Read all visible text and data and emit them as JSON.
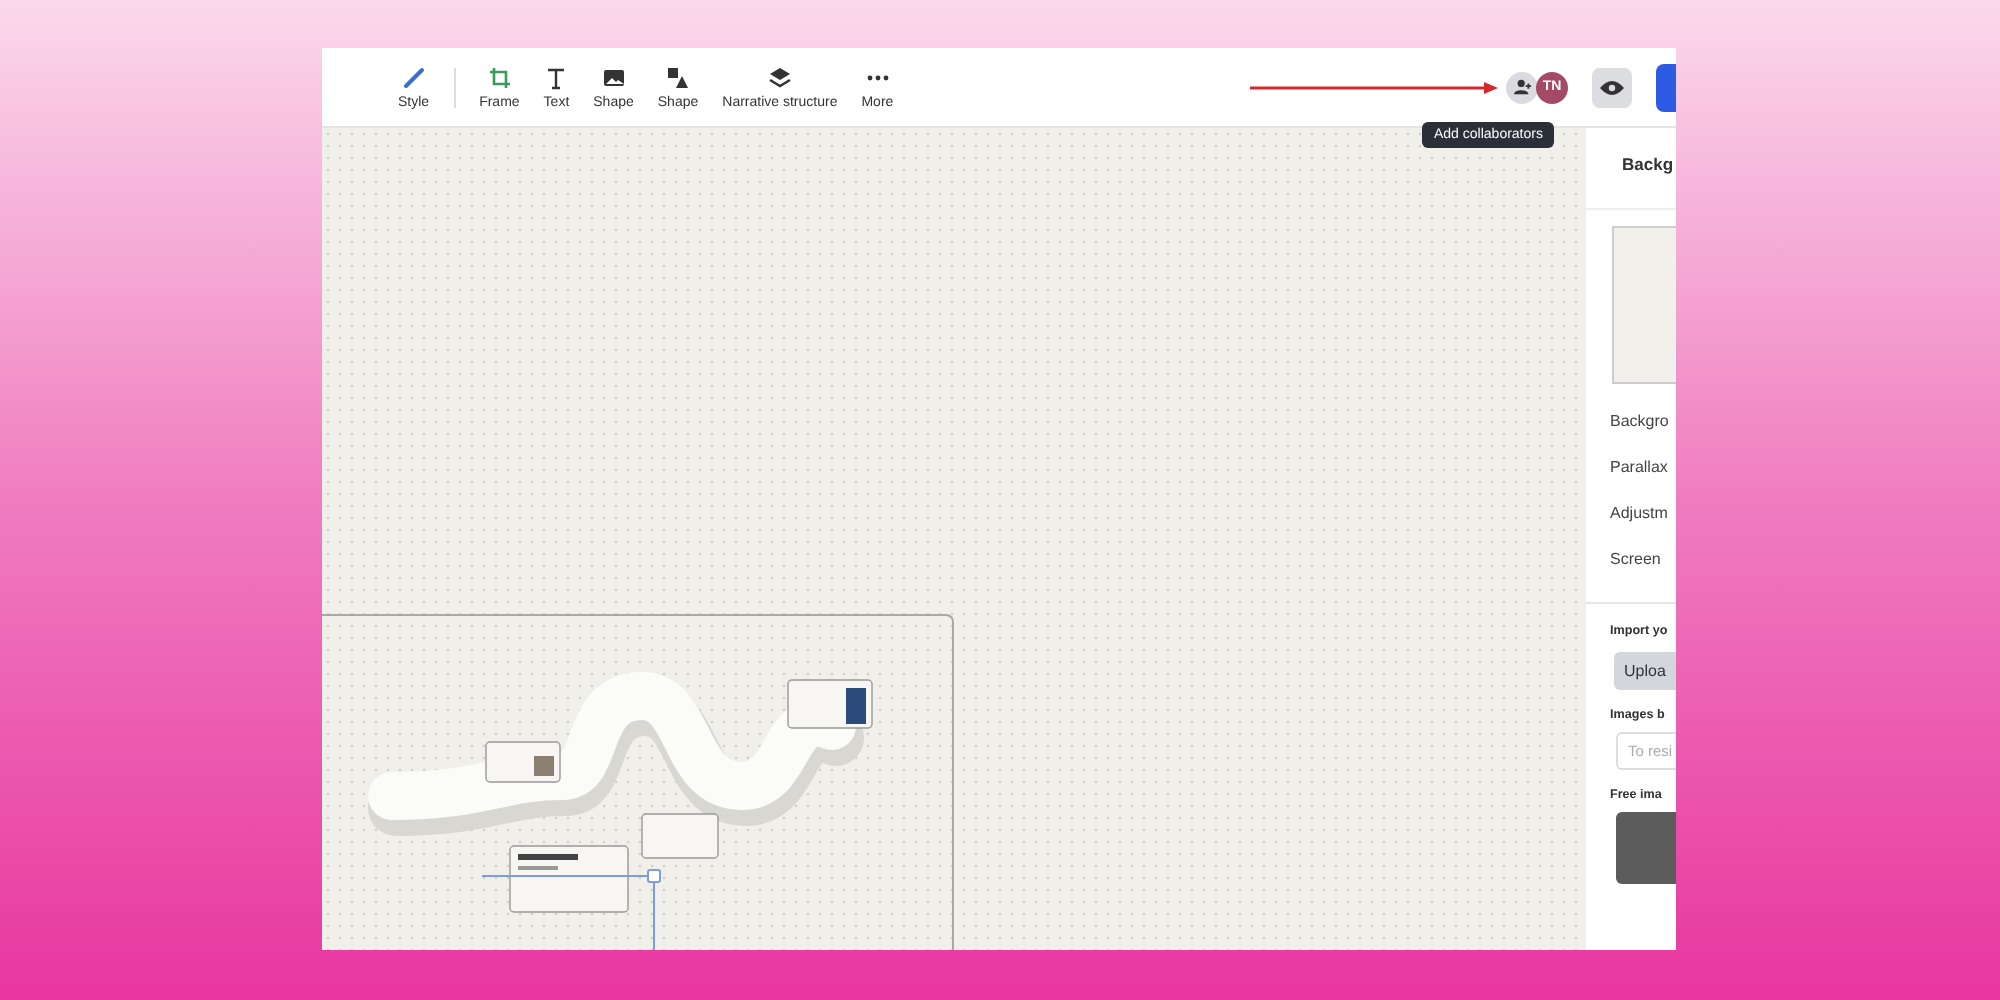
{
  "toolbar": {
    "tools": [
      {
        "label": "Style"
      },
      {
        "label": "Frame"
      },
      {
        "label": "Text"
      },
      {
        "label": "Shape"
      },
      {
        "label": "Shape"
      },
      {
        "label": "Narrative structure"
      },
      {
        "label": "More"
      }
    ],
    "avatar": "TN",
    "tooltip": "Add collaborators"
  },
  "panel": {
    "title": "Backg",
    "rows": [
      "Backgro",
      "Parallax",
      "Adjustm",
      "Screen"
    ],
    "import_label": "Import yo",
    "upload_button": "Uploa",
    "images_label": "Images b",
    "search": {
      "placeholder": "To resi"
    },
    "free_label": "Free ima"
  }
}
